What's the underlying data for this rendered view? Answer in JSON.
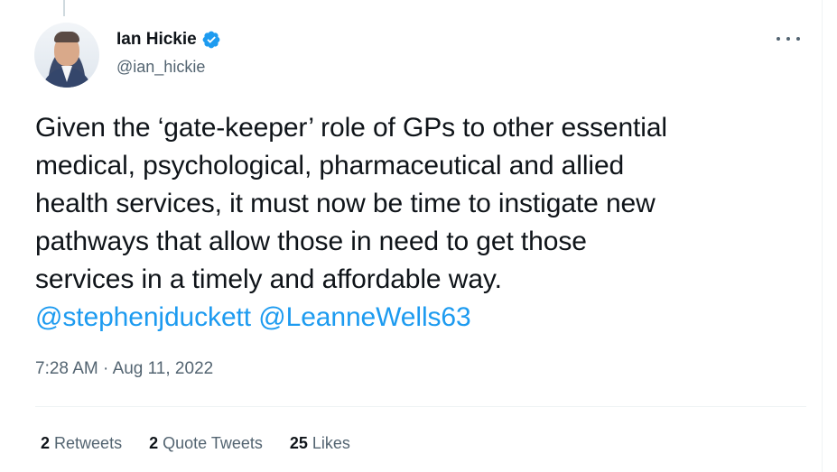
{
  "author": {
    "display_name": "Ian Hickie",
    "handle": "@ian_hickie",
    "verified": true
  },
  "tweet": {
    "text_lines": [
      "Given the ‘gate-keeper’ role of GPs to other essential",
      "medical, psychological, pharmaceutical and allied",
      "health services, it must now be time to instigate new",
      "pathways that allow those in need to get those",
      "services in a timely and affordable way."
    ],
    "mentions": [
      "@stephenjduckett",
      "@LeanneWells63"
    ],
    "time": "7:28 AM",
    "separator": "·",
    "date": "Aug 11, 2022"
  },
  "stats": {
    "retweets_count": "2",
    "retweets_label": "Retweets",
    "quote_tweets_count": "2",
    "quote_tweets_label": "Quote Tweets",
    "likes_count": "25",
    "likes_label": "Likes"
  },
  "icons": {
    "verified": "verified-badge-icon",
    "more": "more-options-icon"
  },
  "colors": {
    "link": "#1d9bf0",
    "secondary_text": "#536471",
    "primary_text": "#0f1419"
  }
}
